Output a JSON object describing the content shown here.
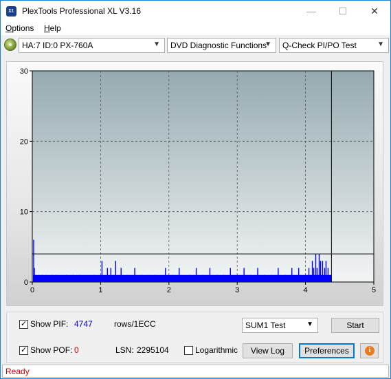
{
  "window": {
    "title": "PlexTools Professional XL V3.16",
    "icon_text": "XL"
  },
  "window_controls": {
    "minimize": "—",
    "maximize": "☐",
    "close": "✕"
  },
  "menu": {
    "options_label": "Options",
    "options_mnemonic": "O",
    "options_rest": "ptions",
    "help_label": "Help",
    "help_mnemonic": "H",
    "help_rest": "elp"
  },
  "toolbar": {
    "drive_value": "HA:7 ID:0  PX-760A",
    "function_value": "DVD Diagnostic Functions",
    "test_value": "Q-Check PI/PO Test"
  },
  "chart_data": {
    "type": "bar",
    "x_ticks": [
      "0",
      "1",
      "2",
      "3",
      "4",
      "5"
    ],
    "y_ticks": [
      "0",
      "10",
      "20",
      "30"
    ],
    "xlim": [
      0,
      5
    ],
    "ylim": [
      0,
      30
    ],
    "grid": true,
    "threshold_line": 4,
    "end_marker_x": 4.38,
    "series": [
      {
        "color": "#0000ff",
        "x": [
          0.02,
          0.03,
          0.05,
          0.1,
          0.15,
          0.2,
          0.3,
          0.35,
          0.5,
          0.6,
          0.7,
          0.9,
          1.0,
          1.02,
          1.1,
          1.15,
          1.2,
          1.22,
          1.3,
          1.4,
          1.5,
          1.6,
          1.7,
          1.8,
          1.95,
          2.05,
          2.15,
          2.3,
          2.4,
          2.5,
          2.6,
          2.7,
          2.8,
          2.9,
          3.0,
          3.1,
          3.2,
          3.3,
          3.4,
          3.5,
          3.6,
          3.7,
          3.8,
          3.9,
          4.0,
          4.05,
          4.08,
          4.1,
          4.12,
          4.15,
          4.17,
          4.2,
          4.22,
          4.25,
          4.28,
          4.3,
          4.33,
          4.36
        ],
        "values": [
          6,
          2,
          1,
          1,
          1,
          1,
          1,
          1,
          1,
          1,
          1,
          1,
          1,
          3,
          2,
          2,
          1,
          3,
          2,
          1,
          2,
          1,
          1,
          1,
          2,
          1,
          2,
          1,
          2,
          1,
          2,
          1,
          1,
          2,
          1,
          2,
          1,
          2,
          1,
          1,
          2,
          1,
          2,
          2,
          1,
          2,
          1,
          3,
          2,
          4,
          2,
          4,
          3,
          3,
          2,
          3,
          2,
          1
        ]
      }
    ]
  },
  "controls": {
    "show_pif_label": "Show PIF:",
    "show_pif_checked": true,
    "pif_value": "4747",
    "rows_label": "rows/1ECC",
    "show_pof_label": "Show POF:",
    "show_pof_checked": true,
    "pof_value": "0",
    "lsn_label": "LSN:",
    "lsn_value": "2295104",
    "logarithmic_label": "Logarithmic",
    "logarithmic_checked": false,
    "sum_select": "SUM1 Test",
    "start_label": "Start",
    "view_log_label": "View Log",
    "preferences_label": "Preferences",
    "info_icon": "i"
  },
  "status": {
    "text": "Ready"
  }
}
